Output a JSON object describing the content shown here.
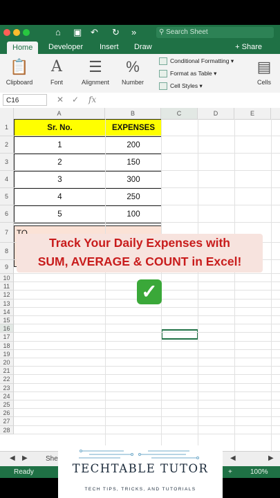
{
  "titlebar": {
    "search_placeholder": "Search Sheet",
    "icons": [
      "home-icon",
      "save-icon",
      "undo-icon",
      "redo-icon",
      "more-icon",
      "search-icon"
    ]
  },
  "tabs": [
    {
      "label": "Home",
      "active": true
    },
    {
      "label": "Developer",
      "active": false
    },
    {
      "label": "Insert",
      "active": false
    },
    {
      "label": "Draw",
      "active": false
    }
  ],
  "share_label": "+ Share",
  "ribbon": {
    "clipboard": "Clipboard",
    "font": "Font",
    "alignment": "Alignment",
    "number": "Number",
    "conditional_formatting": "Conditional Formatting",
    "format_as_table": "Format as Table",
    "cell_styles": "Cell Styles",
    "cells": "Cells"
  },
  "formula_bar": {
    "name_box": "C16",
    "fx": "fx",
    "value": ""
  },
  "columns": [
    "A",
    "B",
    "C",
    "D",
    "E"
  ],
  "rows": [
    "1",
    "2",
    "3",
    "4",
    "5",
    "6",
    "7",
    "8",
    "9",
    "10",
    "11",
    "12",
    "13",
    "14",
    "15",
    "16",
    "17",
    "18",
    "19",
    "20",
    "21",
    "22",
    "23",
    "24",
    "25",
    "26",
    "27",
    "28"
  ],
  "table": {
    "headers": [
      "Sr. No.",
      "EXPENSES"
    ],
    "rows": [
      [
        "1",
        "200"
      ],
      [
        "2",
        "150"
      ],
      [
        "3",
        "300"
      ],
      [
        "4",
        "250"
      ],
      [
        "5",
        "100"
      ]
    ],
    "total_partial": "TO"
  },
  "overlay": {
    "line1": "Track Your Daily Expenses with",
    "line2": "SUM, AVERAGE & COUNT in Excel!"
  },
  "sheet_tab": "She",
  "status": {
    "ready": "Ready",
    "zoom": "100%"
  },
  "logo": {
    "title": "TECHTABLE TUTOR",
    "tagline": "TECH TIPS, TRICKS, AND TUTORIALS"
  },
  "colors": {
    "excel_green": "#1f7145",
    "header_yellow": "#ffff00",
    "overlay_red": "#c81c1c",
    "check_green": "#3aa839"
  }
}
